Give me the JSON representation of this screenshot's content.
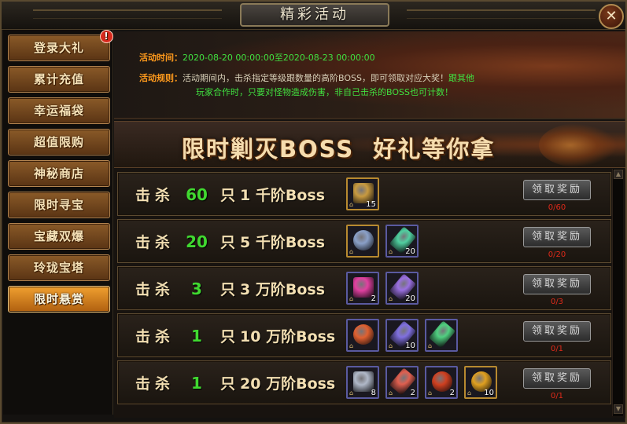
{
  "title": "精彩活动",
  "close_glyph": "✕",
  "sidebar": {
    "items": [
      {
        "label": "登录大礼",
        "badge": "!"
      },
      {
        "label": "累计充值"
      },
      {
        "label": "幸运福袋"
      },
      {
        "label": "超值限购"
      },
      {
        "label": "神秘商店"
      },
      {
        "label": "限时寻宝"
      },
      {
        "label": "宝藏双爆"
      },
      {
        "label": "玲珑宝塔"
      },
      {
        "label": "限时悬赏"
      }
    ],
    "active_index": 8
  },
  "info": {
    "time_label": "活动时间：",
    "time_value": "2020-08-20 00:00:00至2020-08-23 00:00:00",
    "rule_label": "活动规则：",
    "rule_text_1": "活动期间内，击杀指定等级跟数量的高阶BOSS，即可领取对应大奖！",
    "rule_text_green_1": "跟其他",
    "rule_text_green_2": "玩家合作时，只要对怪物造成伤害，非自己击杀的BOSS也可计数！"
  },
  "banner": {
    "title": "限时剿灭BOSS  好礼等你拿"
  },
  "rows": [
    {
      "kill": "击杀",
      "count": "60",
      "unit": "只",
      "boss": "1 千阶Boss",
      "claim": "领取奖励",
      "progress": "0/60",
      "items": [
        {
          "icon": "treasure-chest-icon",
          "count": "15",
          "color": "#c89a40"
        }
      ]
    },
    {
      "kill": "击杀",
      "count": "20",
      "unit": "只",
      "boss": "5 千阶Boss",
      "claim": "领取奖励",
      "progress": "0/20",
      "items": [
        {
          "icon": "silver-compass-icon",
          "count": "",
          "color": "#8aa0c8"
        },
        {
          "icon": "green-crystal-icon",
          "count": "20",
          "color": "#50d0a0"
        }
      ]
    },
    {
      "kill": "击杀",
      "count": "3",
      "unit": "只",
      "boss": "3 万阶Boss",
      "claim": "领取奖励",
      "progress": "0/3",
      "items": [
        {
          "icon": "pink-gem-icon",
          "count": "2",
          "color": "#e040a0"
        },
        {
          "icon": "purple-crystal-icon",
          "count": "20",
          "color": "#9a70e0"
        }
      ]
    },
    {
      "kill": "击杀",
      "count": "1",
      "unit": "只",
      "boss": "10 万阶Boss",
      "claim": "领取奖励",
      "progress": "0/1",
      "items": [
        {
          "icon": "rainbow-orb-icon",
          "count": "",
          "color": "#e06030"
        },
        {
          "icon": "purple-feather-icon",
          "count": "10",
          "color": "#8070e0"
        },
        {
          "icon": "green-crystal-icon",
          "count": "",
          "color": "#50d080"
        }
      ]
    },
    {
      "kill": "击杀",
      "count": "1",
      "unit": "只",
      "boss": "20 万阶Boss",
      "claim": "领取奖励",
      "progress": "0/1",
      "items": [
        {
          "icon": "silver-ore-icon",
          "count": "8",
          "color": "#b0b8c8"
        },
        {
          "icon": "red-crystal-icon",
          "count": "2",
          "color": "#e06050"
        },
        {
          "icon": "red-orb-icon",
          "count": "2",
          "color": "#d04020"
        },
        {
          "icon": "legend-coin-icon",
          "count": "10",
          "color": "#e0a020"
        }
      ]
    }
  ],
  "item_lock_glyph": "🔒"
}
